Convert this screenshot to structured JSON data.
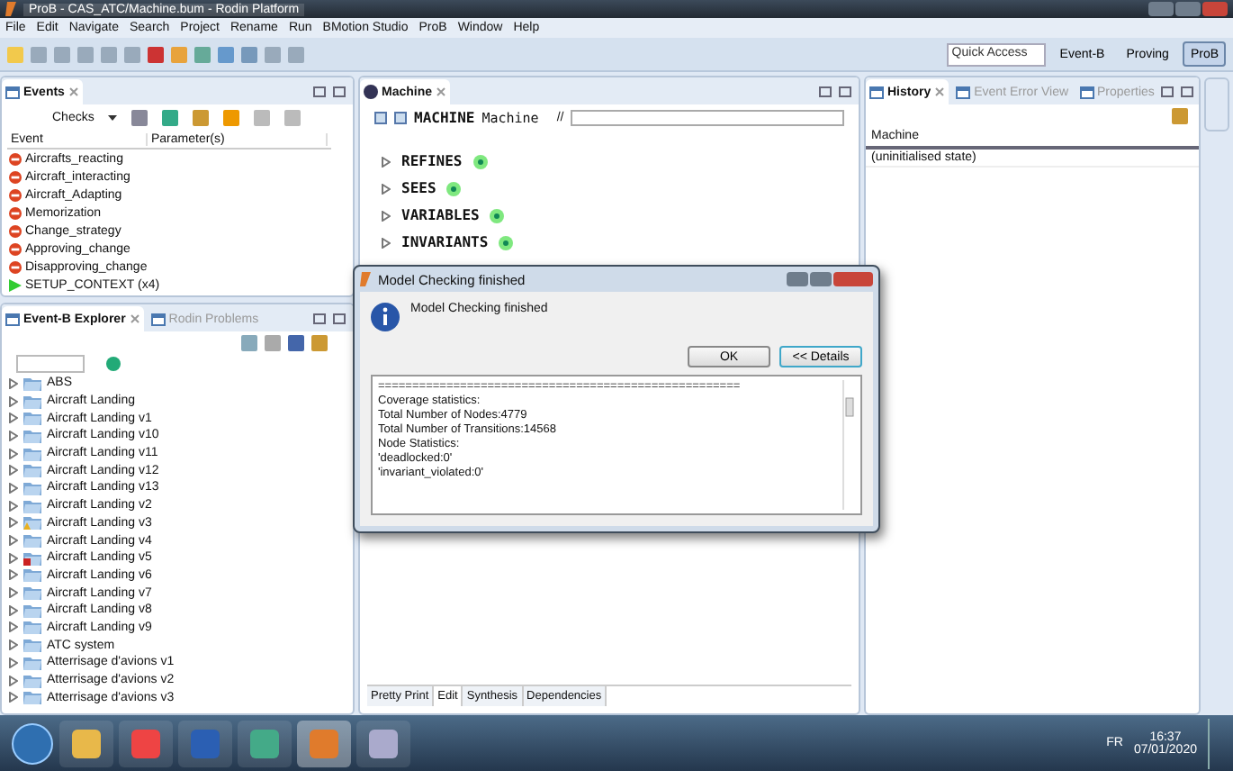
{
  "window": {
    "title": "ProB - CAS_ATC/Machine.bum - Rodin Platform"
  },
  "menu": [
    "File",
    "Edit",
    "Navigate",
    "Search",
    "Project",
    "Rename",
    "Run",
    "BMotion Studio",
    "ProB",
    "Window",
    "Help"
  ],
  "toolbar": {
    "quick_access": "Quick Access",
    "perspectives": [
      {
        "label": "Event-B",
        "selected": false
      },
      {
        "label": "Proving",
        "selected": false
      },
      {
        "label": "ProB",
        "selected": true
      }
    ]
  },
  "events_view": {
    "tabs": [
      {
        "label": "Events",
        "selected": true
      }
    ],
    "checks": "Checks",
    "columns": [
      "Event",
      "Parameter(s)"
    ],
    "rows": [
      {
        "name": "Aircrafts_reacting",
        "kind": "disabled"
      },
      {
        "name": "Aircraft_interacting",
        "kind": "disabled"
      },
      {
        "name": "Aircraft_Adapting",
        "kind": "disabled"
      },
      {
        "name": "Memorization",
        "kind": "disabled"
      },
      {
        "name": "Change_strategy",
        "kind": "disabled"
      },
      {
        "name": "Approving_change",
        "kind": "disabled"
      },
      {
        "name": "Disapproving_change",
        "kind": "disabled"
      },
      {
        "name": "SETUP_CONTEXT (x4)",
        "kind": "enabled"
      }
    ]
  },
  "explorer": {
    "tabs": [
      {
        "label": "Event-B Explorer",
        "selected": true
      },
      {
        "label": "Rodin Problems",
        "selected": false
      }
    ],
    "items": [
      {
        "label": "ABS",
        "kind": "plain"
      },
      {
        "label": "Aircraft Landing",
        "kind": "plain"
      },
      {
        "label": "Aircraft Landing v1",
        "kind": "plain"
      },
      {
        "label": "Aircraft Landing v10",
        "kind": "plain"
      },
      {
        "label": "Aircraft Landing v11",
        "kind": "plain"
      },
      {
        "label": "Aircraft Landing v12",
        "kind": "plain"
      },
      {
        "label": "Aircraft Landing v13",
        "kind": "plain"
      },
      {
        "label": "Aircraft Landing v2",
        "kind": "plain"
      },
      {
        "label": "Aircraft Landing v3",
        "kind": "warning"
      },
      {
        "label": "Aircraft Landing v4",
        "kind": "plain"
      },
      {
        "label": "Aircraft Landing v5",
        "kind": "error"
      },
      {
        "label": "Aircraft Landing v6",
        "kind": "plain"
      },
      {
        "label": "Aircraft Landing v7",
        "kind": "plain"
      },
      {
        "label": "Aircraft Landing v8",
        "kind": "plain"
      },
      {
        "label": "Aircraft Landing v9",
        "kind": "plain"
      },
      {
        "label": "ATC system",
        "kind": "plain"
      },
      {
        "label": "Atterrisage d'avions v1",
        "kind": "plain"
      },
      {
        "label": "Atterrisage d'avions v2",
        "kind": "plain"
      },
      {
        "label": "Atterrisage d'avions v3",
        "kind": "plain"
      }
    ]
  },
  "editor": {
    "tab": "Machine",
    "keyword": "MACHINE",
    "name": "Machine",
    "comment_mark": "//",
    "sections": [
      "REFINES",
      "SEES",
      "VARIABLES",
      "INVARIANTS"
    ],
    "bottom_tabs": [
      {
        "label": "Pretty Print",
        "selected": false
      },
      {
        "label": "Edit",
        "selected": true
      },
      {
        "label": "Synthesis",
        "selected": false
      },
      {
        "label": "Dependencies",
        "selected": false
      }
    ]
  },
  "history": {
    "tabs": [
      {
        "label": "History",
        "selected": true
      },
      {
        "label": "Event Error View",
        "selected": false
      },
      {
        "label": "Properties",
        "selected": false
      }
    ],
    "column": "Machine",
    "rows": [
      "(uninitialised state)"
    ]
  },
  "dialog": {
    "title": "Model Checking finished",
    "message": "Model Checking finished",
    "buttons": [
      {
        "label": "OK",
        "selected": false
      },
      {
        "label": "<< Details",
        "selected": true
      }
    ],
    "details": [
      "=====================================================",
      "Coverage statistics:",
      "Total Number of Nodes:4779",
      "Total Number of Transitions:14568",
      "Node Statistics:",
      "'deadlocked:0'",
      "'invariant_violated:0'"
    ]
  },
  "taskbar": {
    "language": "FR",
    "time": "16:37",
    "date": "07/01/2020"
  }
}
